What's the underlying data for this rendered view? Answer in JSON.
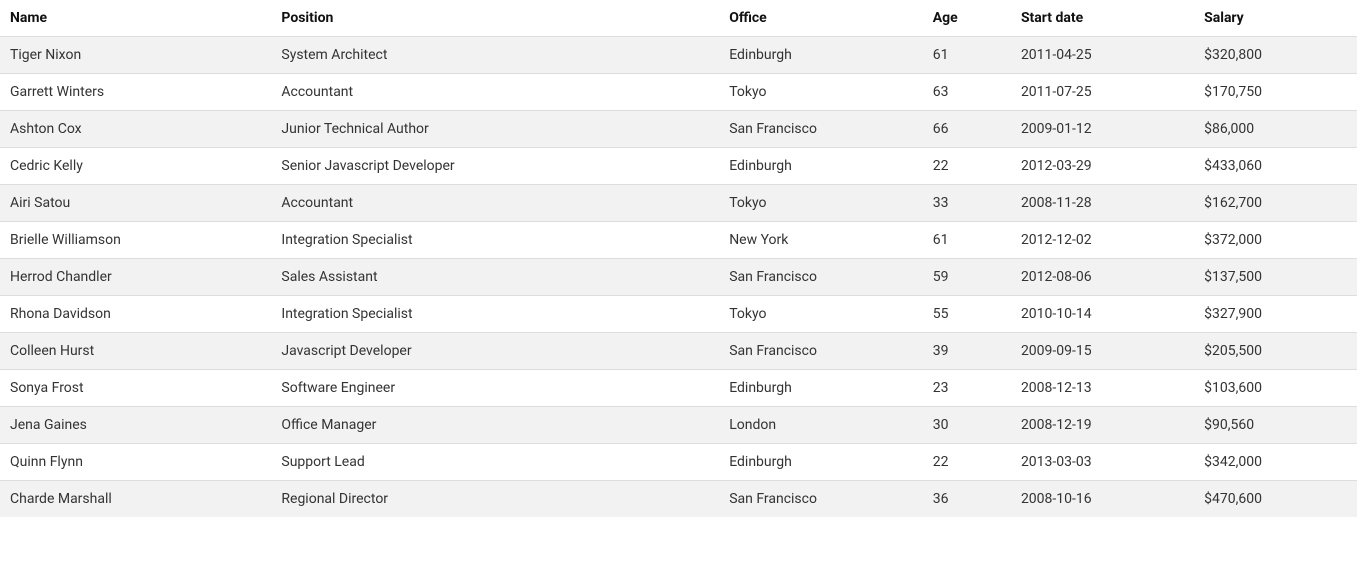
{
  "table": {
    "columns": [
      {
        "key": "name",
        "label": "Name"
      },
      {
        "key": "position",
        "label": "Position"
      },
      {
        "key": "office",
        "label": "Office"
      },
      {
        "key": "age",
        "label": "Age"
      },
      {
        "key": "start_date",
        "label": "Start date"
      },
      {
        "key": "salary",
        "label": "Salary"
      }
    ],
    "rows": [
      {
        "name": "Tiger Nixon",
        "position": "System Architect",
        "office": "Edinburgh",
        "age": "61",
        "start_date": "2011-04-25",
        "salary": "$320,800"
      },
      {
        "name": "Garrett Winters",
        "position": "Accountant",
        "office": "Tokyo",
        "age": "63",
        "start_date": "2011-07-25",
        "salary": "$170,750"
      },
      {
        "name": "Ashton Cox",
        "position": "Junior Technical Author",
        "office": "San Francisco",
        "age": "66",
        "start_date": "2009-01-12",
        "salary": "$86,000"
      },
      {
        "name": "Cedric Kelly",
        "position": "Senior Javascript Developer",
        "office": "Edinburgh",
        "age": "22",
        "start_date": "2012-03-29",
        "salary": "$433,060"
      },
      {
        "name": "Airi Satou",
        "position": "Accountant",
        "office": "Tokyo",
        "age": "33",
        "start_date": "2008-11-28",
        "salary": "$162,700"
      },
      {
        "name": "Brielle Williamson",
        "position": "Integration Specialist",
        "office": "New York",
        "age": "61",
        "start_date": "2012-12-02",
        "salary": "$372,000"
      },
      {
        "name": "Herrod Chandler",
        "position": "Sales Assistant",
        "office": "San Francisco",
        "age": "59",
        "start_date": "2012-08-06",
        "salary": "$137,500"
      },
      {
        "name": "Rhona Davidson",
        "position": "Integration Specialist",
        "office": "Tokyo",
        "age": "55",
        "start_date": "2010-10-14",
        "salary": "$327,900"
      },
      {
        "name": "Colleen Hurst",
        "position": "Javascript Developer",
        "office": "San Francisco",
        "age": "39",
        "start_date": "2009-09-15",
        "salary": "$205,500"
      },
      {
        "name": "Sonya Frost",
        "position": "Software Engineer",
        "office": "Edinburgh",
        "age": "23",
        "start_date": "2008-12-13",
        "salary": "$103,600"
      },
      {
        "name": "Jena Gaines",
        "position": "Office Manager",
        "office": "London",
        "age": "30",
        "start_date": "2008-12-19",
        "salary": "$90,560"
      },
      {
        "name": "Quinn Flynn",
        "position": "Support Lead",
        "office": "Edinburgh",
        "age": "22",
        "start_date": "2013-03-03",
        "salary": "$342,000"
      },
      {
        "name": "Charde Marshall",
        "position": "Regional Director",
        "office": "San Francisco",
        "age": "36",
        "start_date": "2008-10-16",
        "salary": "$470,600"
      }
    ]
  }
}
